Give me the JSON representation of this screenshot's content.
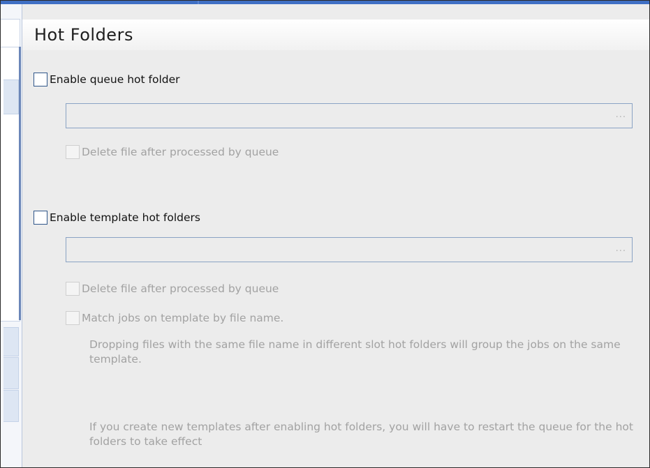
{
  "page": {
    "title": "Hot Folders"
  },
  "queue_hot_folder": {
    "enable_label": "Enable queue hot folder",
    "enabled": false,
    "path_value": "",
    "browse_label": "...",
    "delete_after_label": "Delete file after processed by queue",
    "delete_after_checked": false
  },
  "template_hot_folders": {
    "enable_label": "Enable template hot folders",
    "enabled": false,
    "path_value": "",
    "browse_label": "...",
    "delete_after_label": "Delete file after processed by queue",
    "delete_after_checked": false,
    "match_by_name_label": "Match jobs on template by file name.",
    "match_by_name_checked": false,
    "match_description": "Dropping files with the same file name in different slot hot folders will group the jobs on the same template.",
    "restart_note": "If you create new templates after enabling hot folders, you will have to restart the queue for the hot folders to take effect"
  },
  "colors": {
    "accent": "#3f6fc4",
    "checkbox_border": "#2f5689",
    "field_border": "#8aa3c4",
    "disabled_text": "#a2a2a2"
  }
}
